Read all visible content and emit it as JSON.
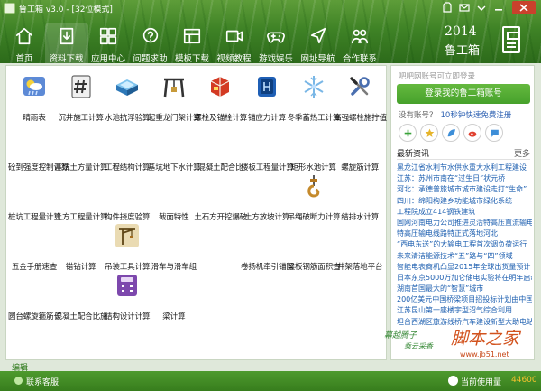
{
  "window": {
    "title": "鲁工箱 v3.0 - [32位模式]"
  },
  "nav": {
    "items": [
      {
        "label": "首页",
        "icon": "home-icon"
      },
      {
        "label": "资料下载",
        "icon": "book-download-icon"
      },
      {
        "label": "应用中心",
        "icon": "apps-icon"
      },
      {
        "label": "问题求助",
        "icon": "help-chat-icon"
      },
      {
        "label": "模板下载",
        "icon": "template-grid-icon"
      },
      {
        "label": "视频教程",
        "icon": "video-icon"
      },
      {
        "label": "游戏娱乐",
        "icon": "gamepad-icon"
      },
      {
        "label": "网址导航",
        "icon": "navigation-arrow-icon"
      },
      {
        "label": "合作联系",
        "icon": "handshake-icon"
      }
    ],
    "active_index": 1
  },
  "brand": {
    "year": "2014",
    "name": "鲁工箱"
  },
  "tools": [
    {
      "label": "晴雨表",
      "icon": "weather-barometer-icon",
      "color": "#4a7bc8"
    },
    {
      "label": "沉井施工计算",
      "icon": "well-hash-icon",
      "color": "#555555"
    },
    {
      "label": "水池抗浮验算",
      "icon": "pool-icon",
      "color": "#2f7fc0"
    },
    {
      "label": "起重龙门架计算",
      "icon": "gantry-crane-icon",
      "color": "#3a3a3a"
    },
    {
      "label": "螺栓及锚栓计算",
      "icon": "bolt-anchor-icon",
      "color": "#d13b26"
    },
    {
      "label": "锚应力计算",
      "icon": "anchor-stress-icon",
      "color": "#1f5fb5"
    },
    {
      "label": "冬季蓄热工计算",
      "icon": "snowflake-icon",
      "color": "#5aa0d8"
    },
    {
      "label": "高强螺栓施拧值",
      "icon": "wrench-screwdriver-icon",
      "color": "#3b63a8"
    },
    {
      "label": "砼到强度控制计算",
      "icon": "",
      "color": ""
    },
    {
      "label": "基坑土方量计算",
      "icon": "",
      "color": ""
    },
    {
      "label": "工程结构计算",
      "icon": "",
      "color": ""
    },
    {
      "label": "基坑地下水计算",
      "icon": "",
      "color": ""
    },
    {
      "label": "混凝土配合比",
      "icon": "",
      "color": ""
    },
    {
      "label": "楼板工程量计算",
      "icon": "",
      "color": ""
    },
    {
      "label": "矩形水池计算",
      "icon": "",
      "color": ""
    },
    {
      "label": "螺旋筋计算",
      "icon": "",
      "color": ""
    },
    {
      "label": "桩坑工程量计算",
      "icon": "",
      "color": ""
    },
    {
      "label": "土方工程量计算",
      "icon": "",
      "color": ""
    },
    {
      "label": "构件挠度验算",
      "icon": "",
      "color": ""
    },
    {
      "label": "截面特性",
      "icon": "",
      "color": ""
    },
    {
      "label": "土石方开挖爆破",
      "icon": "",
      "color": ""
    },
    {
      "label": "土方放坡计算",
      "icon": "",
      "color": ""
    },
    {
      "label": "吊绳破断力计算",
      "icon": "rope-hook-icon",
      "color": "#c58a2c"
    },
    {
      "label": "结排水计算",
      "icon": "",
      "color": ""
    },
    {
      "label": "五金手册速查",
      "icon": "",
      "color": ""
    },
    {
      "label": "错钻计算",
      "icon": "",
      "color": ""
    },
    {
      "label": "吊装工具计算",
      "icon": "crane-icon",
      "color": "#8b6a2a"
    },
    {
      "label": "滑车与滑车组",
      "icon": "",
      "color": ""
    },
    {
      "label": "",
      "icon": "",
      "color": ""
    },
    {
      "label": "卷扬机牵引锚固",
      "icon": "",
      "color": ""
    },
    {
      "label": "梁板钢筋面积查",
      "icon": "",
      "color": ""
    },
    {
      "label": "井架落地平台",
      "icon": "",
      "color": ""
    },
    {
      "label": "圆台螺旋箍筋长",
      "icon": "",
      "color": ""
    },
    {
      "label": "混凝土配合比施",
      "icon": "",
      "color": ""
    },
    {
      "label": "结构设计计算",
      "icon": "calculator-icon",
      "color": "#6e3d9c"
    },
    {
      "label": "梁计算",
      "icon": "",
      "color": ""
    },
    {
      "label": "",
      "icon": "",
      "color": ""
    },
    {
      "label": "",
      "icon": "",
      "color": ""
    },
    {
      "label": "",
      "icon": "",
      "color": ""
    },
    {
      "label": "",
      "icon": "",
      "color": ""
    }
  ],
  "content": {
    "edit_link": "编辑"
  },
  "sidebar": {
    "hint": "吧吧网账号可立即登录",
    "login_button": "登录我的鲁工箱账号",
    "no_account": "没有账号？",
    "register_link": "10秒钟快速免费注册",
    "social": [
      {
        "icon": "add-icon",
        "color": "#3aa33a"
      },
      {
        "icon": "star-icon",
        "color": "#e6b42a"
      },
      {
        "icon": "leaf-icon",
        "color": "#3d8ed8"
      },
      {
        "icon": "weibo-icon",
        "color": "#e0402f"
      },
      {
        "icon": "chat-icon",
        "color": "#3d8ed8"
      }
    ],
    "news_title": "最新资讯",
    "news_more": "更多",
    "news": [
      "黑龙江省水利节水供水重大水利工程建设",
      "江苏：苏州市南在“过生日”状元桥",
      "河北：承德普旅城市城市建设走打“生命”",
      "四川：绵阳构建乡功能城市绿化系统",
      "工程院成立414钢铁建筑",
      "国网河南电力公司推进灵活特高压直流输电线",
      "特高压输电线路特正式落地河北",
      "“西电东送”的大输电工程首次调负荷运行",
      "未来清洁能源技术“五”路与“四”领域",
      "智能电表商机凸显2015年全球出货量预计",
      "日本东京5000万加仑储电实验将在明年启动",
      "湖南首国最大的“智慧”城市",
      "200亿美元中国桥梁项目招投标计划由中国",
      "江苏昆山第一座楼宇型沼气综合利用",
      "坦台西湖区旅游线桥汽车建设新型大助电站"
    ]
  },
  "watermark": {
    "line1": "幕越腾子",
    "line2": "乘云采香",
    "main": "脚本之家",
    "url": "www.jb51.net"
  },
  "status": {
    "left": "联系客服",
    "usage_label": "当前使用量",
    "usage_value": "44600"
  }
}
